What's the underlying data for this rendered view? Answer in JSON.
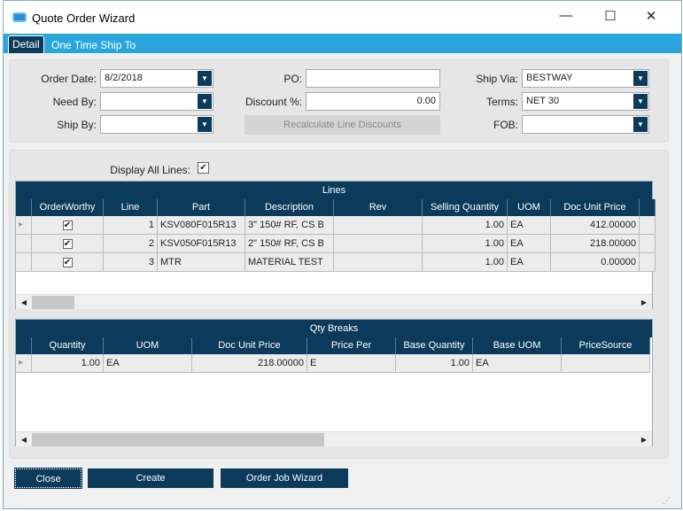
{
  "window": {
    "title": "Quote Order Wizard",
    "minimize": "—",
    "maximize": "☐",
    "close": "✕"
  },
  "tabs": [
    {
      "label": "Detail"
    },
    {
      "label": "One Time Ship To"
    }
  ],
  "form": {
    "order_date_label": "Order Date:",
    "order_date": "8/2/2018",
    "need_by_label": "Need By:",
    "need_by": "",
    "ship_by_label": "Ship By:",
    "ship_by": "",
    "po_label": "PO:",
    "po": "",
    "discount_label": "Discount %:",
    "discount": "0.00",
    "recalc_label": "Recalculate Line Discounts",
    "ship_via_label": "Ship Via:",
    "ship_via": "BESTWAY",
    "terms_label": "Terms:",
    "terms": "NET 30",
    "fob_label": "FOB:",
    "fob": "",
    "display_all_label": "Display All Lines:",
    "display_all": true
  },
  "lines": {
    "title": "Lines",
    "columns": [
      "OrderWorthy",
      "Line",
      "Part",
      "Description",
      "Rev",
      "Selling Quantity",
      "UOM",
      "Doc Unit Price",
      ""
    ],
    "rows": [
      [
        true,
        "1",
        "KSV080F015R13",
        "3\" 150# RF, CS B",
        "",
        "1.00",
        "EA",
        "412.00000",
        ""
      ],
      [
        true,
        "2",
        "KSV050F015R13",
        "2\" 150# RF, CS B",
        "",
        "1.00",
        "EA",
        "218.00000",
        ""
      ],
      [
        true,
        "3",
        "MTR",
        "MATERIAL TEST",
        "",
        "1.00",
        "EA",
        "0.00000",
        ""
      ]
    ]
  },
  "qty_breaks": {
    "title": "Qty Breaks",
    "columns": [
      "Quantity",
      "UOM",
      "Doc Unit Price",
      "Price Per",
      "Base Quantity",
      "Base UOM",
      "PriceSource"
    ],
    "rows": [
      [
        "1.00",
        "EA",
        "218.00000",
        "E",
        "1.00",
        "EA",
        ""
      ]
    ]
  },
  "buttons": {
    "close": "Close",
    "create": "Create",
    "order_job_wizard": "Order Job Wizard"
  }
}
